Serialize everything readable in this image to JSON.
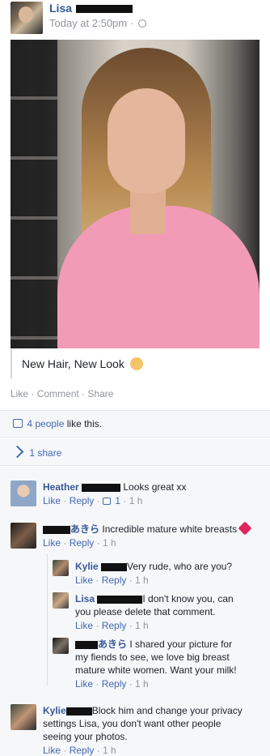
{
  "post": {
    "author": "Lisa",
    "time": "Today at 2:50pm",
    "caption": "New Hair, New Look",
    "actions": {
      "like": "Like",
      "comment": "Comment",
      "share": "Share",
      "sep": "·"
    }
  },
  "stats": {
    "likes_count": "4 people",
    "likes_suffix": "like this.",
    "shares": "1 share"
  },
  "comments": [
    {
      "author": "Heather",
      "text": "Looks great xx",
      "like": "Like",
      "reply": "Reply",
      "likes": "1",
      "time": "1 h"
    },
    {
      "author": "あきら",
      "text": "Incredible mature white breasts",
      "like": "Like",
      "reply": "Reply",
      "time": "1 h",
      "replies": [
        {
          "author": "Kylie",
          "text": "Very rude, who are you?",
          "like": "Like",
          "reply": "Reply",
          "time": "1 h"
        },
        {
          "author": "Lisa",
          "text_line1": "I don't know you, can",
          "text_line2": "you please delete that comment.",
          "like": "Like",
          "reply": "Reply",
          "time": "1 h"
        },
        {
          "author": "あきら",
          "text_line1": "I shared your picture for",
          "text_line2": "my fiends to see, we love big breast",
          "text_line3": "mature white women. Want your milk!",
          "like": "Like",
          "reply": "Reply",
          "time": "1 h"
        }
      ]
    },
    {
      "author": "Kylie",
      "text_line1": "Block him and change your privacy",
      "text_line2": "settings Lisa, you don't want other people",
      "text_line3": "seeing your photos.",
      "like": "Like",
      "reply": "Reply",
      "time": "1 h"
    }
  ]
}
